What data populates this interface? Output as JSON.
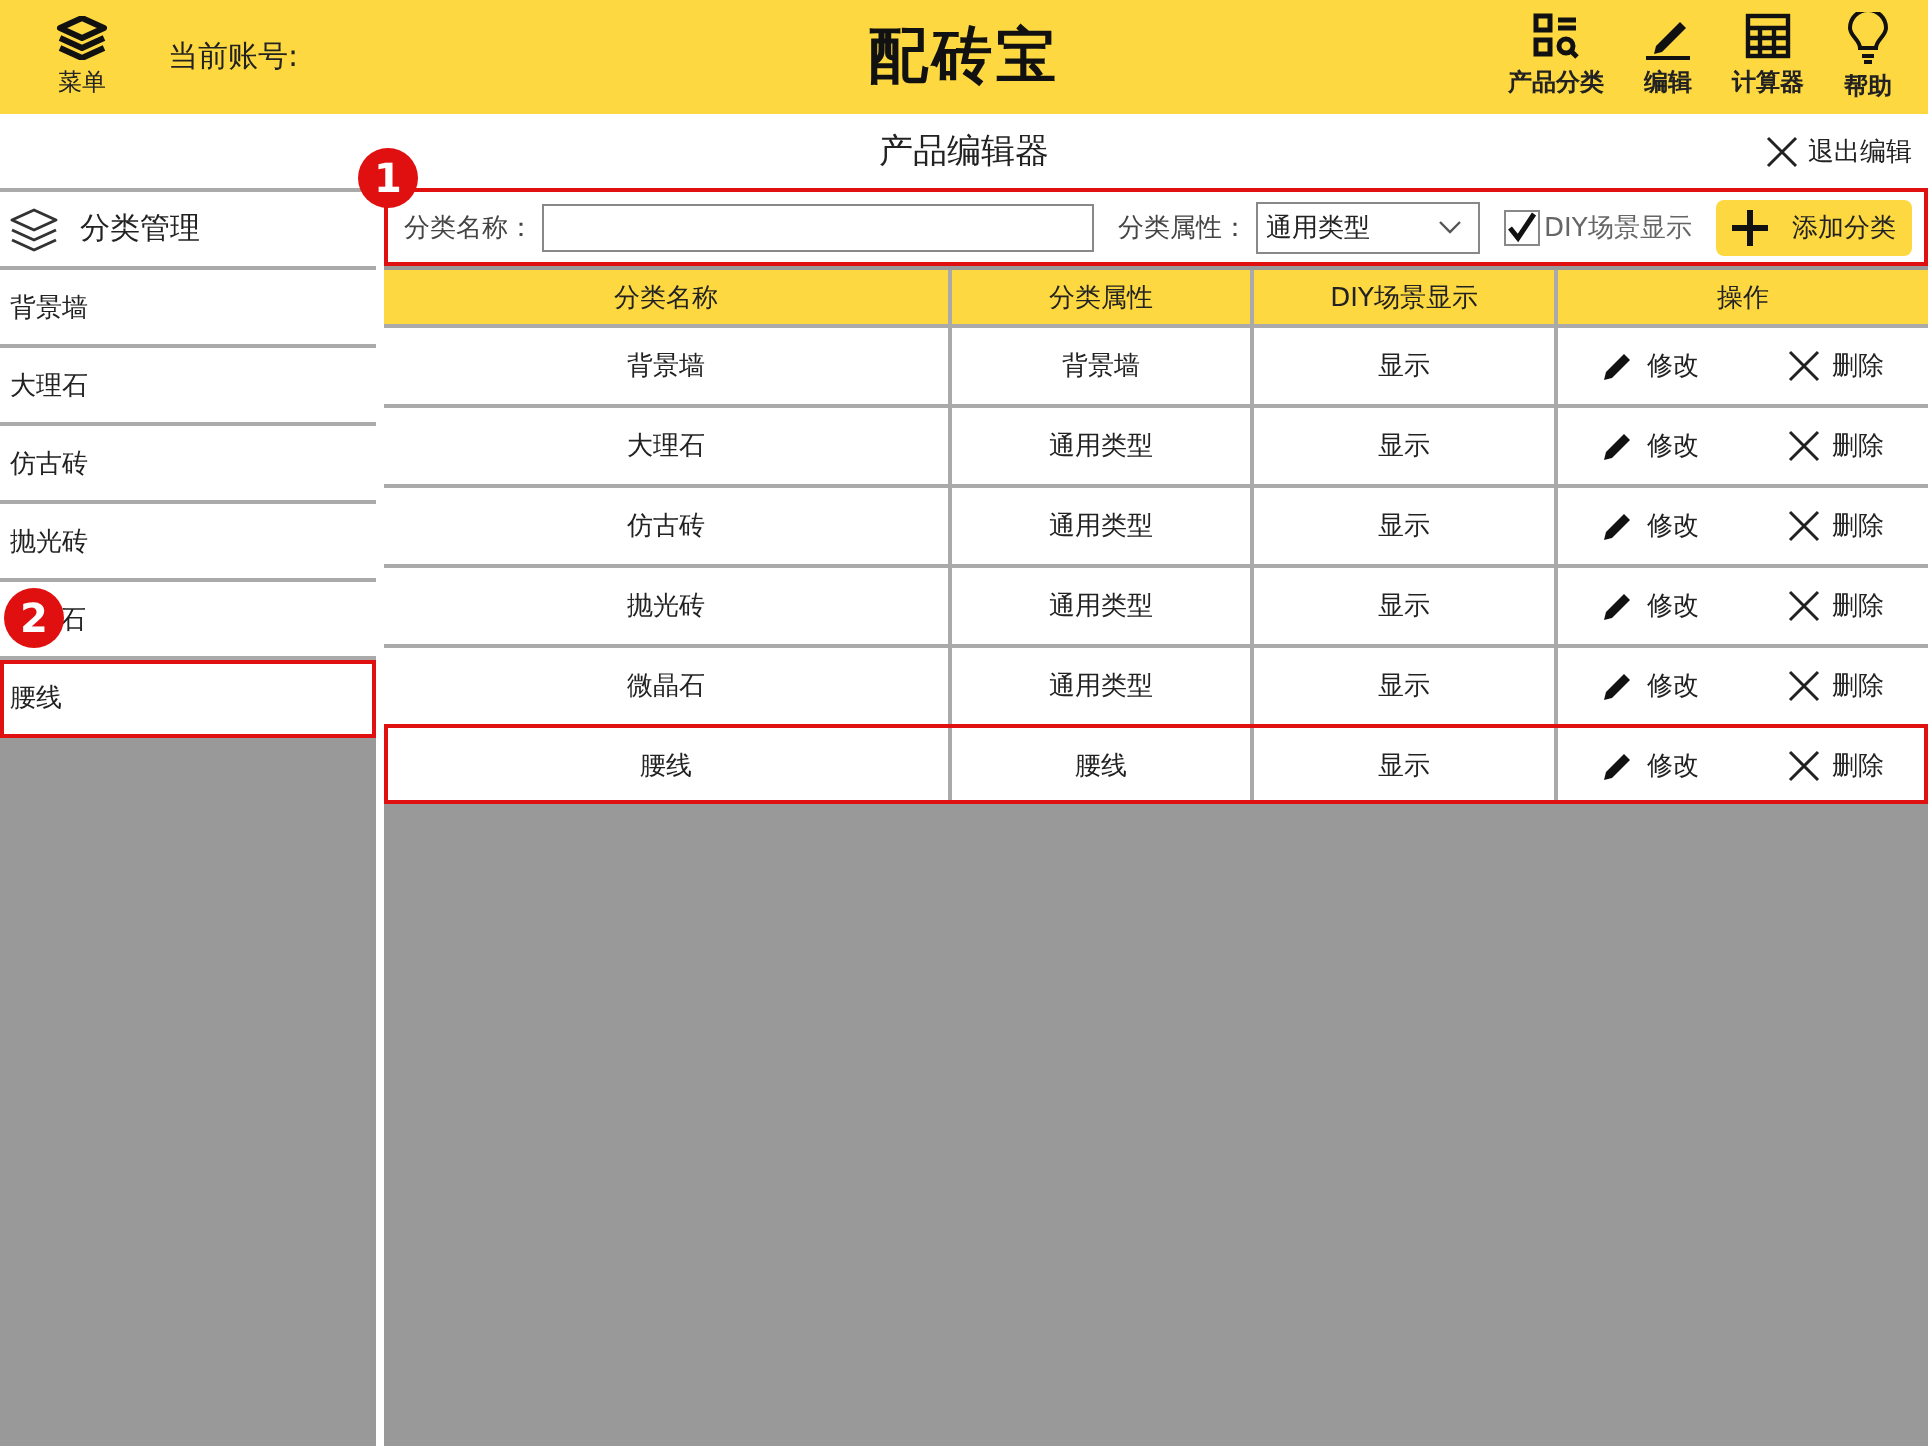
{
  "header": {
    "menu_label": "菜单",
    "account_label": "当前账号:",
    "app_title": "配砖宝",
    "nav": [
      {
        "label": "产品分类",
        "kind": "category"
      },
      {
        "label": "编辑",
        "kind": "edit"
      },
      {
        "label": "计算器",
        "kind": "calculator"
      },
      {
        "label": "帮助",
        "kind": "help"
      }
    ]
  },
  "page_title": "产品编辑器",
  "exit_label": "退出编辑",
  "sidebar": {
    "title": "分类管理",
    "items": [
      {
        "label": "背景墙",
        "highlighted": false
      },
      {
        "label": "大理石",
        "highlighted": false
      },
      {
        "label": "仿古砖",
        "highlighted": false
      },
      {
        "label": "抛光砖",
        "highlighted": false
      },
      {
        "label": "石",
        "highlighted": false,
        "badge": "2"
      },
      {
        "label": "腰线",
        "highlighted": true
      }
    ]
  },
  "toolbar": {
    "badge": "1",
    "name_label": "分类名称：",
    "attribute_label": "分类属性：",
    "attribute_value": "通用类型",
    "diy": {
      "label": "DIY场景显示",
      "checked": true
    },
    "add_button": "添加分类"
  },
  "table": {
    "columns": [
      "分类名称",
      "分类属性",
      "DIY场景显示",
      "操作"
    ],
    "rows": [
      {
        "name": "背景墙",
        "attribute": "背景墙",
        "diy": "显示",
        "edit": "修改",
        "delete": "删除",
        "highlighted": false
      },
      {
        "name": "大理石",
        "attribute": "通用类型",
        "diy": "显示",
        "edit": "修改",
        "delete": "删除",
        "highlighted": false
      },
      {
        "name": "仿古砖",
        "attribute": "通用类型",
        "diy": "显示",
        "edit": "修改",
        "delete": "删除",
        "highlighted": false
      },
      {
        "name": "抛光砖",
        "attribute": "通用类型",
        "diy": "显示",
        "edit": "修改",
        "delete": "删除",
        "highlighted": false
      },
      {
        "name": "微晶石",
        "attribute": "通用类型",
        "diy": "显示",
        "edit": "修改",
        "delete": "删除",
        "highlighted": false
      },
      {
        "name": "腰线",
        "attribute": "腰线",
        "diy": "显示",
        "edit": "修改",
        "delete": "删除",
        "highlighted": true
      }
    ]
  }
}
